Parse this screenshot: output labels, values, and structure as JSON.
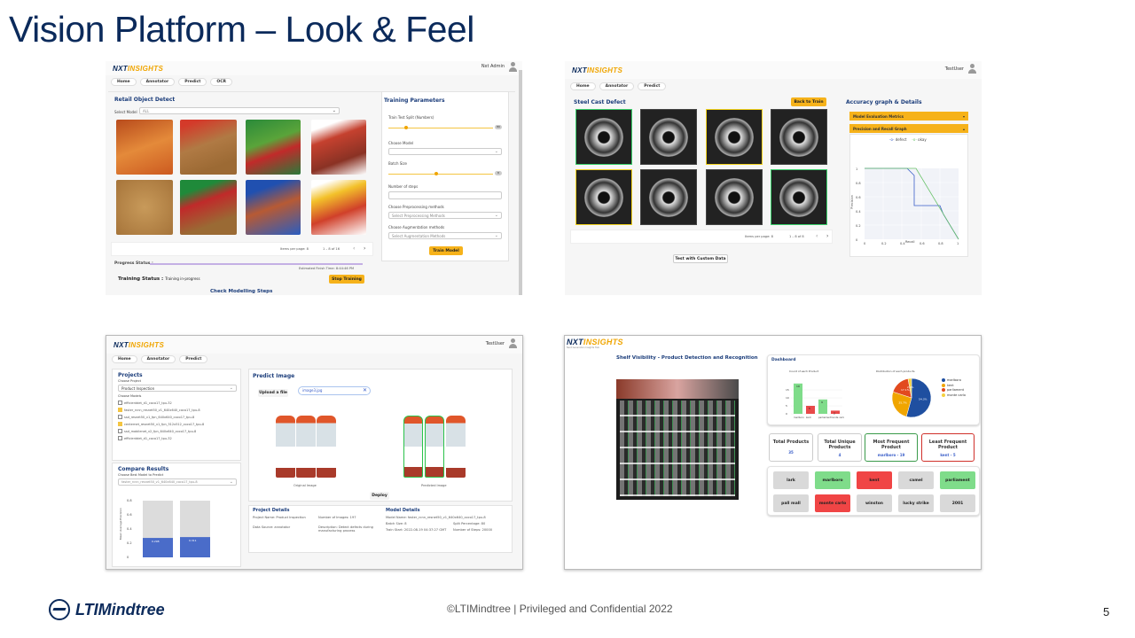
{
  "slide": {
    "title": "Vision Platform – Look & Feel",
    "footer_logo": "LTIMindtree",
    "copyright": "©LTIMindtree | Privileged and Confidential 2022",
    "page_number": "5"
  },
  "app": {
    "logo_prefix": "NXT",
    "logo_suffix": "INSIGHTS"
  },
  "s1": {
    "user": "Nxt Admin",
    "tabs": [
      "Home",
      "Annotator",
      "Predict",
      "OCR"
    ],
    "section_title": "Retail Object Detect",
    "select_model_label": "Select Model",
    "select_model_value": "ALL",
    "pager_items": "Items per page:  8",
    "pager_range": "1 – 8 of 16",
    "progress_label": "Progress Status :",
    "est_time": "Estimated Finish Time: 8:44:46 PM",
    "training_status_label": "Training Status :",
    "training_status_value": "Training in-progress",
    "stop_button": "Stop Training",
    "check_link": "Check Modelling Steps",
    "params_title": "Training Parameters",
    "split_label": "Train Test Split (Numbers)",
    "split_value": "80",
    "choose_model_label": "Choose Model",
    "batch_label": "Batch Size",
    "batch_value": "8",
    "steps_label": "Number of steps",
    "preproc_label": "Choose Preprocessing methods",
    "preproc_placeholder": "Select Preprocessing Methods",
    "aug_label": "Choose Augmentation methods",
    "aug_placeholder": "Select Augmentation Methods",
    "train_button": "Train Model"
  },
  "s2": {
    "user": "TestUser",
    "tabs": [
      "Home",
      "Annotator",
      "Predict"
    ],
    "section_title": "Steel Cast Defect",
    "back_button": "Back to Train",
    "pager_items": "Items per page:  8",
    "pager_range": "1 – 8 of 8",
    "test_button": "Test with Custom Data",
    "accuracy_title": "Accuracy graph & Details",
    "acc_metrics": "Model Evaluation Metrics",
    "acc_pr": "Precision and Recall Graph",
    "legend": [
      "defect",
      "okay"
    ],
    "ylabel": "Precision",
    "xlabel": "Recall"
  },
  "s3": {
    "user": "TestUser",
    "tabs": [
      "Home",
      "Annotator",
      "Predict"
    ],
    "projects_title": "Projects",
    "choose_project_label": "Choose Project",
    "choose_project_value": "Product Inspection",
    "choose_models_label": "Choose Models",
    "models": [
      {
        "name": "efficientdet_d1_coco17_tpu-32",
        "checked": false
      },
      {
        "name": "faster_rcnn_resnet50_v1_640x640_coco17_tpu-8",
        "checked": true
      },
      {
        "name": "ssd_resnet50_v1_fpn_640x640_coco17_tpu-8",
        "checked": false
      },
      {
        "name": "centernet_resnet50_v1_fpn_512x512_coco17_tpu-8",
        "checked": true
      },
      {
        "name": "ssd_mobilenet_v2_fpn_640x640_coco17_tpu-8",
        "checked": false
      },
      {
        "name": "efficientdet_d1_coco17_tpu-32",
        "checked": false
      }
    ],
    "compare_title": "Compare Results",
    "best_model_label": "Choose Best Model to Predict",
    "best_model_value": "faster_rcnn_resnet50_v1_640x640_coco17_tpu-8",
    "predict_title": "Predict Image",
    "upload_button": "Upload a file",
    "file_chip": "image3.jpg",
    "original_caption": "Original Image",
    "predicted_caption": "Predicted Image",
    "deploy_button": "Deploy",
    "project_details_title": "Project Details",
    "model_details_title": "Model Details",
    "pd_project_name": "Project Name: Product Inspection",
    "pd_num_images": "Number of Images: 197",
    "pd_source": "Data Source: annotator",
    "pd_description": "Description: Detect defects during manufacturing process",
    "md_model_name": "Model Name: faster_rcnn_resnet50_v1_640x640_coco17_tpu-8",
    "md_batch": "Batch Size: 8",
    "md_split": "Split Percentage: 80",
    "md_train_start": "Train Start: 2022-08-19 04:37:27 GMT",
    "md_steps": "Number of Steps: 20000",
    "bar_values": [
      0.298,
      0.311
    ],
    "bar_labels": [
      "0.298",
      "0.311"
    ],
    "bar_ylabel": "Mean Average Precision",
    "bar_yticks": [
      "0",
      "0.2",
      "0.4",
      "0.6",
      "0.8"
    ]
  },
  "s4": {
    "logo_tagline": "Next Generation Insights Hub",
    "title": "Shelf Visibility - Product Detection and Recognition",
    "dashboard_title": "Dashboard",
    "count_chart_title": "Count of each Product",
    "dist_chart_title": "Distribution of each products",
    "pie_legend": [
      "marlboro",
      "kent",
      "parliament",
      "monte carlo"
    ],
    "pie_colors": [
      "#1f4fa0",
      "#f0a500",
      "#e24a1f",
      "#f4d03f"
    ],
    "pie_values": [
      54.3,
      25.7,
      17.1,
      2.9
    ],
    "bar_cats": [
      "marlboro",
      "kent",
      "parliament",
      "monte carlo"
    ],
    "bar_values": [
      19,
      5,
      9,
      2
    ],
    "cards": [
      {
        "title": "Total Products",
        "value": "35"
      },
      {
        "title": "Total Unique Products",
        "value": "4"
      },
      {
        "title": "Most Frequent Product",
        "value": "marlboro - 19"
      },
      {
        "title": "Least Frequent Product",
        "value": "kent - 5"
      }
    ],
    "brands": [
      {
        "name": "lark",
        "status": "none"
      },
      {
        "name": "marlboro",
        "status": "found"
      },
      {
        "name": "kent",
        "status": "alert"
      },
      {
        "name": "camel",
        "status": "none"
      },
      {
        "name": "parliament",
        "status": "found"
      },
      {
        "name": "pall mall",
        "status": "none"
      },
      {
        "name": "monte carlo",
        "status": "alert"
      },
      {
        "name": "winston",
        "status": "none"
      },
      {
        "name": "lucky strike",
        "status": "none"
      },
      {
        "name": "2001",
        "status": "none"
      }
    ]
  }
}
